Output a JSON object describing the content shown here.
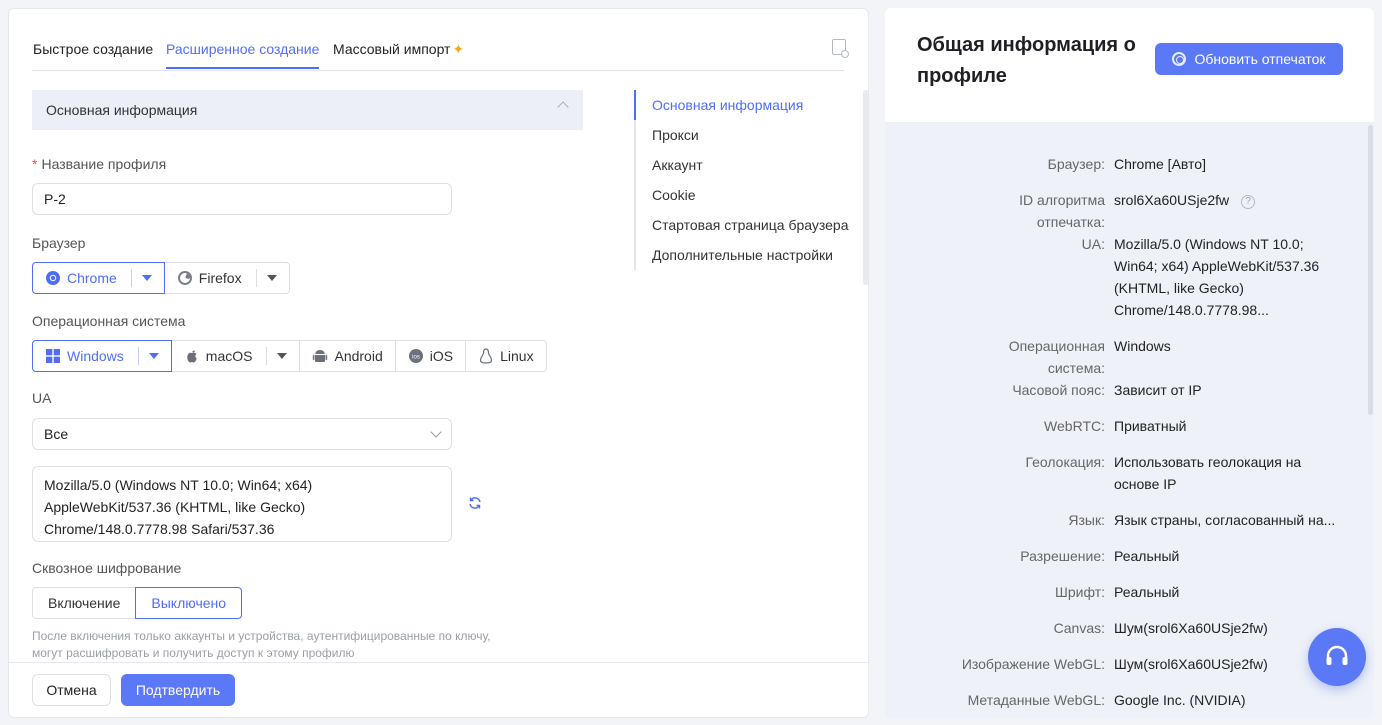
{
  "tabs": [
    {
      "label": "Быстрое создание"
    },
    {
      "label": "Расширенное создание"
    },
    {
      "label": "Массовый импорт"
    }
  ],
  "section": {
    "title": "Основная информация"
  },
  "profile_name": {
    "label": "Название профиля",
    "value": "P-2"
  },
  "browser": {
    "label": "Браузер",
    "options": [
      {
        "label": "Chrome"
      },
      {
        "label": "Firefox"
      }
    ]
  },
  "os": {
    "label": "Операционная система",
    "options": [
      {
        "label": "Windows"
      },
      {
        "label": "macOS"
      },
      {
        "label": "Android"
      },
      {
        "label": "iOS"
      },
      {
        "label": "Linux"
      }
    ]
  },
  "ua": {
    "label": "UA",
    "select_value": "Все",
    "text": "Mozilla/5.0 (Windows NT 10.0; Win64; x64) AppleWebKit/537.36 (KHTML, like Gecko) Chrome/148.0.7778.98 Safari/537.36"
  },
  "encryption": {
    "label": "Сквозное шифрование",
    "on": "Включение",
    "off": "Выключено",
    "hint": "После включения только аккаунты и устройства, аутентифицированные по ключу, могут расшифровать и получить доступ к этому профилю"
  },
  "footer": {
    "cancel": "Отмена",
    "confirm": "Подтвердить"
  },
  "anchors": [
    {
      "label": "Основная информация"
    },
    {
      "label": "Прокси"
    },
    {
      "label": "Аккаунт"
    },
    {
      "label": "Cookie"
    },
    {
      "label": "Стартовая страница браузера"
    },
    {
      "label": "Дополнительные настройки"
    }
  ],
  "summary": {
    "title": "Общая информация о профиле",
    "refresh_button": "Обновить отпечаток",
    "rows": [
      {
        "key": "Браузер:",
        "value": "Chrome [Авто]"
      },
      {
        "key": "ID алгоритма отпечатка:",
        "value": "srol6Xa60USje2fw"
      },
      {
        "key": "UA:",
        "value": "Mozilla/5.0 (Windows NT 10.0; Win64; x64) AppleWebKit/537.36 (KHTML, like Gecko) Chrome/148.0.7778.98..."
      },
      {
        "key": "Операционная система:",
        "value": "Windows"
      },
      {
        "key": "Часовой пояс:",
        "value": "Зависит от IP"
      },
      {
        "key": "WebRTC:",
        "value": "Приватный"
      },
      {
        "key": "Геолокация:",
        "value": "Использовать геолокация на основе IP"
      },
      {
        "key": "Язык:",
        "value": "Язык страны, согласованный на..."
      },
      {
        "key": "Разрешение:",
        "value": "Реальный"
      },
      {
        "key": "Шрифт:",
        "value": "Реальный"
      },
      {
        "key": "Canvas:",
        "value": "Шум(srol6Xa60USje2fw)"
      },
      {
        "key": "Изображение WebGL:",
        "value": "Шум(srol6Xa60USje2fw)"
      },
      {
        "key": "Метаданные WebGL:",
        "value": "Google Inc. (NVIDIA)"
      }
    ]
  },
  "colors": {
    "accent": "#4f6ef5",
    "button": "#5b78f6",
    "panel_bg": "#eef1f8"
  },
  "icons": [
    "doc-search-icon",
    "chrome-icon",
    "firefox-icon",
    "windows-icon",
    "apple-icon",
    "android-icon",
    "ios-icon",
    "linux-icon",
    "refresh-icon",
    "fingerprint-icon",
    "help-icon",
    "headset-icon"
  ]
}
